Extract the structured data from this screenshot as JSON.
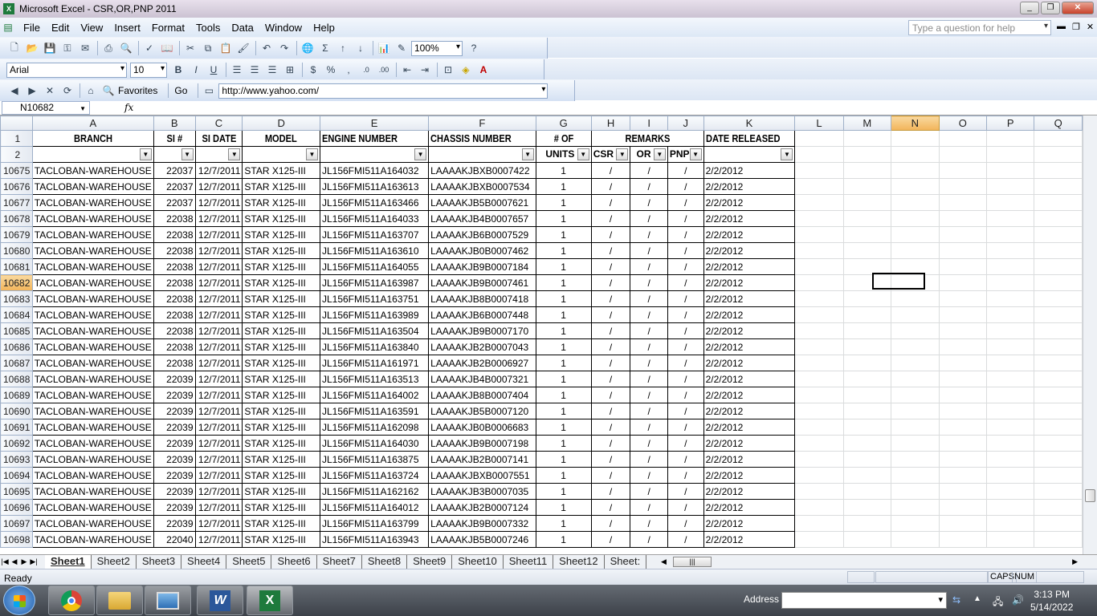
{
  "window": {
    "title": "Microsoft Excel - CSR,OR,PNP 2011"
  },
  "menu": [
    "File",
    "Edit",
    "View",
    "Insert",
    "Format",
    "Tools",
    "Data",
    "Window",
    "Help"
  ],
  "help_placeholder": "Type a question for help",
  "toolbar": {
    "zoom": "100%",
    "font": "Arial",
    "font_size": "10",
    "favorites": "Favorites",
    "go": "Go",
    "url": "http://www.yahoo.com/"
  },
  "name_box": "N10682",
  "fx": "fx",
  "columns": [
    "A",
    "B",
    "C",
    "D",
    "E",
    "F",
    "G",
    "H",
    "I",
    "J",
    "K",
    "L",
    "M",
    "N",
    "O",
    "P",
    "Q"
  ],
  "header1": {
    "branch": "BRANCH",
    "si": "SI #",
    "sidate": "SI DATE",
    "model": "MODEL",
    "engine": "ENGINE NUMBER",
    "chassis": "CHASSIS NUMBER",
    "units": "# OF",
    "remarks": "REMARKS",
    "released": "DATE RELEASED"
  },
  "header2": {
    "units": "UNITS",
    "csr": "CSR",
    "or": "OR",
    "pnp": "PNP"
  },
  "row_labels": [
    "1",
    "2"
  ],
  "rows": [
    {
      "n": "10675",
      "branch": "TACLOBAN-WAREHOUSE",
      "si": "22037",
      "date": "12/7/2011",
      "model": "STAR X125-III",
      "engine": "JL156FMI511A164032",
      "chassis": "LAAAAKJBXB0007422",
      "units": "1",
      "csr": "/",
      "or": "/",
      "pnp": "/",
      "released": "2/2/2012"
    },
    {
      "n": "10676",
      "branch": "TACLOBAN-WAREHOUSE",
      "si": "22037",
      "date": "12/7/2011",
      "model": "STAR X125-III",
      "engine": "JL156FMI511A163613",
      "chassis": "LAAAAKJBXB0007534",
      "units": "1",
      "csr": "/",
      "or": "/",
      "pnp": "/",
      "released": "2/2/2012"
    },
    {
      "n": "10677",
      "branch": "TACLOBAN-WAREHOUSE",
      "si": "22037",
      "date": "12/7/2011",
      "model": "STAR X125-III",
      "engine": "JL156FMI511A163466",
      "chassis": "LAAAAKJB5B0007621",
      "units": "1",
      "csr": "/",
      "or": "/",
      "pnp": "/",
      "released": "2/2/2012"
    },
    {
      "n": "10678",
      "branch": "TACLOBAN-WAREHOUSE",
      "si": "22038",
      "date": "12/7/2011",
      "model": "STAR X125-III",
      "engine": "JL156FMI511A164033",
      "chassis": "LAAAAKJB4B0007657",
      "units": "1",
      "csr": "/",
      "or": "/",
      "pnp": "/",
      "released": "2/2/2012"
    },
    {
      "n": "10679",
      "branch": "TACLOBAN-WAREHOUSE",
      "si": "22038",
      "date": "12/7/2011",
      "model": "STAR X125-III",
      "engine": "JL156FMI511A163707",
      "chassis": "LAAAAKJB6B0007529",
      "units": "1",
      "csr": "/",
      "or": "/",
      "pnp": "/",
      "released": "2/2/2012"
    },
    {
      "n": "10680",
      "branch": "TACLOBAN-WAREHOUSE",
      "si": "22038",
      "date": "12/7/2011",
      "model": "STAR X125-III",
      "engine": "JL156FMI511A163610",
      "chassis": "LAAAAKJB0B0007462",
      "units": "1",
      "csr": "/",
      "or": "/",
      "pnp": "/",
      "released": "2/2/2012"
    },
    {
      "n": "10681",
      "branch": "TACLOBAN-WAREHOUSE",
      "si": "22038",
      "date": "12/7/2011",
      "model": "STAR X125-III",
      "engine": "JL156FMI511A164055",
      "chassis": "LAAAAKJB9B0007184",
      "units": "1",
      "csr": "/",
      "or": "/",
      "pnp": "/",
      "released": "2/2/2012"
    },
    {
      "n": "10682",
      "branch": "TACLOBAN-WAREHOUSE",
      "si": "22038",
      "date": "12/7/2011",
      "model": "STAR X125-III",
      "engine": "JL156FMI511A163987",
      "chassis": "LAAAAKJB9B0007461",
      "units": "1",
      "csr": "/",
      "or": "/",
      "pnp": "/",
      "released": "2/2/2012"
    },
    {
      "n": "10683",
      "branch": "TACLOBAN-WAREHOUSE",
      "si": "22038",
      "date": "12/7/2011",
      "model": "STAR X125-III",
      "engine": "JL156FMI511A163751",
      "chassis": "LAAAAKJB8B0007418",
      "units": "1",
      "csr": "/",
      "or": "/",
      "pnp": "/",
      "released": "2/2/2012"
    },
    {
      "n": "10684",
      "branch": "TACLOBAN-WAREHOUSE",
      "si": "22038",
      "date": "12/7/2011",
      "model": "STAR X125-III",
      "engine": "JL156FMI511A163989",
      "chassis": "LAAAAKJB6B0007448",
      "units": "1",
      "csr": "/",
      "or": "/",
      "pnp": "/",
      "released": "2/2/2012"
    },
    {
      "n": "10685",
      "branch": "TACLOBAN-WAREHOUSE",
      "si": "22038",
      "date": "12/7/2011",
      "model": "STAR X125-III",
      "engine": "JL156FMI511A163504",
      "chassis": "LAAAAKJB9B0007170",
      "units": "1",
      "csr": "/",
      "or": "/",
      "pnp": "/",
      "released": "2/2/2012"
    },
    {
      "n": "10686",
      "branch": "TACLOBAN-WAREHOUSE",
      "si": "22038",
      "date": "12/7/2011",
      "model": "STAR X125-III",
      "engine": "JL156FMI511A163840",
      "chassis": "LAAAAKJB2B0007043",
      "units": "1",
      "csr": "/",
      "or": "/",
      "pnp": "/",
      "released": "2/2/2012"
    },
    {
      "n": "10687",
      "branch": "TACLOBAN-WAREHOUSE",
      "si": "22038",
      "date": "12/7/2011",
      "model": "STAR X125-III",
      "engine": "JL156FMI511A161971",
      "chassis": "LAAAAKJB2B0006927",
      "units": "1",
      "csr": "/",
      "or": "/",
      "pnp": "/",
      "released": "2/2/2012"
    },
    {
      "n": "10688",
      "branch": "TACLOBAN-WAREHOUSE",
      "si": "22039",
      "date": "12/7/2011",
      "model": "STAR X125-III",
      "engine": "JL156FMI511A163513",
      "chassis": "LAAAAKJB4B0007321",
      "units": "1",
      "csr": "/",
      "or": "/",
      "pnp": "/",
      "released": "2/2/2012"
    },
    {
      "n": "10689",
      "branch": "TACLOBAN-WAREHOUSE",
      "si": "22039",
      "date": "12/7/2011",
      "model": "STAR X125-III",
      "engine": "JL156FMI511A164002",
      "chassis": "LAAAAKJB8B0007404",
      "units": "1",
      "csr": "/",
      "or": "/",
      "pnp": "/",
      "released": "2/2/2012"
    },
    {
      "n": "10690",
      "branch": "TACLOBAN-WAREHOUSE",
      "si": "22039",
      "date": "12/7/2011",
      "model": "STAR X125-III",
      "engine": "JL156FMI511A163591",
      "chassis": "LAAAAKJB5B0007120",
      "units": "1",
      "csr": "/",
      "or": "/",
      "pnp": "/",
      "released": "2/2/2012"
    },
    {
      "n": "10691",
      "branch": "TACLOBAN-WAREHOUSE",
      "si": "22039",
      "date": "12/7/2011",
      "model": "STAR X125-III",
      "engine": "JL156FMI511A162098",
      "chassis": "LAAAAKJB0B0006683",
      "units": "1",
      "csr": "/",
      "or": "/",
      "pnp": "/",
      "released": "2/2/2012"
    },
    {
      "n": "10692",
      "branch": "TACLOBAN-WAREHOUSE",
      "si": "22039",
      "date": "12/7/2011",
      "model": "STAR X125-III",
      "engine": "JL156FMI511A164030",
      "chassis": "LAAAAKJB9B0007198",
      "units": "1",
      "csr": "/",
      "or": "/",
      "pnp": "/",
      "released": "2/2/2012"
    },
    {
      "n": "10693",
      "branch": "TACLOBAN-WAREHOUSE",
      "si": "22039",
      "date": "12/7/2011",
      "model": "STAR X125-III",
      "engine": "JL156FMI511A163875",
      "chassis": "LAAAAKJB2B0007141",
      "units": "1",
      "csr": "/",
      "or": "/",
      "pnp": "/",
      "released": "2/2/2012"
    },
    {
      "n": "10694",
      "branch": "TACLOBAN-WAREHOUSE",
      "si": "22039",
      "date": "12/7/2011",
      "model": "STAR X125-III",
      "engine": "JL156FMI511A163724",
      "chassis": "LAAAAKJBXB0007551",
      "units": "1",
      "csr": "/",
      "or": "/",
      "pnp": "/",
      "released": "2/2/2012"
    },
    {
      "n": "10695",
      "branch": "TACLOBAN-WAREHOUSE",
      "si": "22039",
      "date": "12/7/2011",
      "model": "STAR X125-III",
      "engine": "JL156FMI511A162162",
      "chassis": "LAAAAKJB3B0007035",
      "units": "1",
      "csr": "/",
      "or": "/",
      "pnp": "/",
      "released": "2/2/2012"
    },
    {
      "n": "10696",
      "branch": "TACLOBAN-WAREHOUSE",
      "si": "22039",
      "date": "12/7/2011",
      "model": "STAR X125-III",
      "engine": "JL156FMI511A164012",
      "chassis": "LAAAAKJB2B0007124",
      "units": "1",
      "csr": "/",
      "or": "/",
      "pnp": "/",
      "released": "2/2/2012"
    },
    {
      "n": "10697",
      "branch": "TACLOBAN-WAREHOUSE",
      "si": "22039",
      "date": "12/7/2011",
      "model": "STAR X125-III",
      "engine": "JL156FMI511A163799",
      "chassis": "LAAAAKJB9B0007332",
      "units": "1",
      "csr": "/",
      "or": "/",
      "pnp": "/",
      "released": "2/2/2012"
    },
    {
      "n": "10698",
      "branch": "TACLOBAN-WAREHOUSE",
      "si": "22040",
      "date": "12/7/2011",
      "model": "STAR X125-III",
      "engine": "JL156FMI511A163943",
      "chassis": "LAAAAKJB5B0007246",
      "units": "1",
      "csr": "/",
      "or": "/",
      "pnp": "/",
      "released": "2/2/2012"
    }
  ],
  "selected_row": "10682",
  "selected_col": "N",
  "sheets": [
    "Sheet1",
    "Sheet2",
    "Sheet3",
    "Sheet4",
    "Sheet5",
    "Sheet6",
    "Sheet7",
    "Sheet8",
    "Sheet9",
    "Sheet10",
    "Sheet11",
    "Sheet12",
    "Sheet:"
  ],
  "active_sheet": "Sheet1",
  "status": {
    "text": "Ready",
    "caps": "CAPS",
    "num": "NUM"
  },
  "taskbar": {
    "address_label": "Address",
    "time": "3:13 PM",
    "date": "5/14/2022"
  },
  "colors": {
    "selection_header": "#f2b45a",
    "excel_green": "#1e7a3c",
    "title_bg": "#cbc2d2"
  }
}
